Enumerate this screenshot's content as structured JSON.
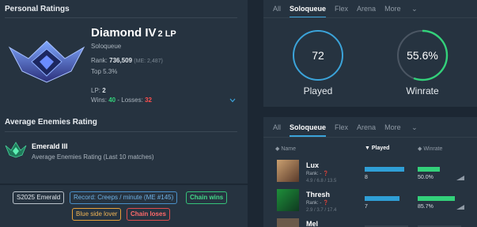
{
  "personal": {
    "title": "Personal Ratings",
    "rank": "Diamond IV",
    "lp_tag": "2 LP",
    "queue": "Soloqueue",
    "rank_label": "Rank:",
    "rank_value": "736,509",
    "rank_me": "(ME: 2,487)",
    "top": "Top 5.3%",
    "lp_label": "LP:",
    "lp_value": "2",
    "wins_label": "Wins:",
    "wins": "40",
    "losses_sep": "-",
    "losses_label": "Losses:",
    "losses": "32"
  },
  "enemies": {
    "title": "Average Enemies Rating",
    "rank": "Emerald III",
    "desc": "Average Enemies Rating (Last 10 matches)"
  },
  "tags": [
    {
      "label": "S2025 Emerald"
    },
    {
      "label": "Record: Creeps / minute (ME #145)"
    },
    {
      "label": "Chain wins"
    },
    {
      "label": "Blue side lover"
    },
    {
      "label": "Chain loses"
    }
  ],
  "tabs_top": [
    "All",
    "Soloqueue",
    "Flex",
    "Arena",
    "More"
  ],
  "tabs_bottom": [
    "All",
    "Soloqueue",
    "Flex",
    "Arena",
    "More"
  ],
  "summary": {
    "played_value": "72",
    "played_label": "Played",
    "winrate_value": "55.6%",
    "winrate_label": "Winrate",
    "winrate_fraction": 0.556
  },
  "table": {
    "col_name": "Name",
    "col_played": "Played",
    "col_winrate": "Winrate",
    "rows": [
      {
        "name": "Lux",
        "rank": "Rank: -",
        "kda": "4.9 / 6.8 / 13.5",
        "played": "8",
        "played_frac": 0.9,
        "winrate": "50.0%",
        "win_frac": 0.5
      },
      {
        "name": "Thresh",
        "rank": "Rank: -",
        "kda": "2.9 / 3.7 / 17.4",
        "played": "7",
        "played_frac": 0.8,
        "winrate": "85.7%",
        "win_frac": 0.857
      },
      {
        "name": "Mel",
        "rank": "",
        "kda": "",
        "played": "",
        "played_frac": 0,
        "winrate": "",
        "win_frac": 0
      }
    ]
  },
  "colors": {
    "accent_blue": "#3ba3d9",
    "win_green": "#33d17a",
    "loss_red": "#ff4e4e"
  }
}
